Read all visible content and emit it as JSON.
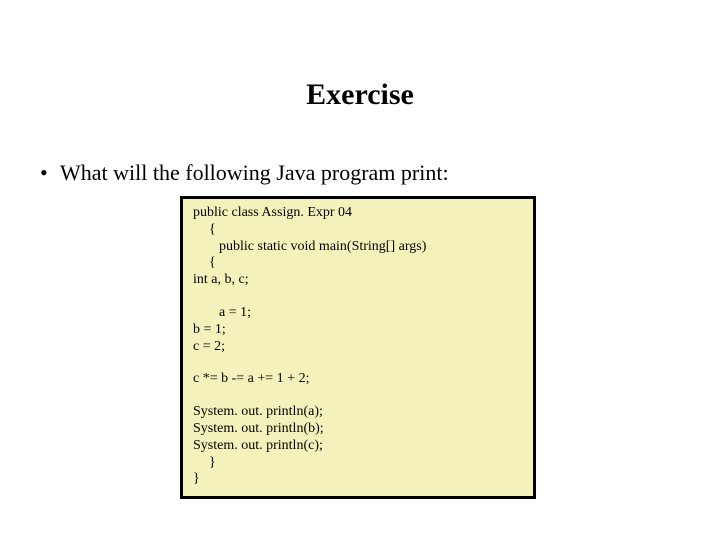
{
  "title": "Exercise",
  "bullet": "What will the following Java program print:",
  "code": {
    "l1": "public class Assign. Expr 04",
    "l2": "{",
    "l3": "public static void main(String[] args)",
    "l4": "{",
    "l5": "int a, b, c;",
    "l6": "a = 1;",
    "l7": "b = 1;",
    "l8": "c = 2;",
    "l9": "c *= b -= a += 1 + 2;",
    "l10": "System. out. println(a);",
    "l11": "System. out. println(b);",
    "l12": "System. out. println(c);",
    "l13": "}",
    "l14": "}"
  }
}
